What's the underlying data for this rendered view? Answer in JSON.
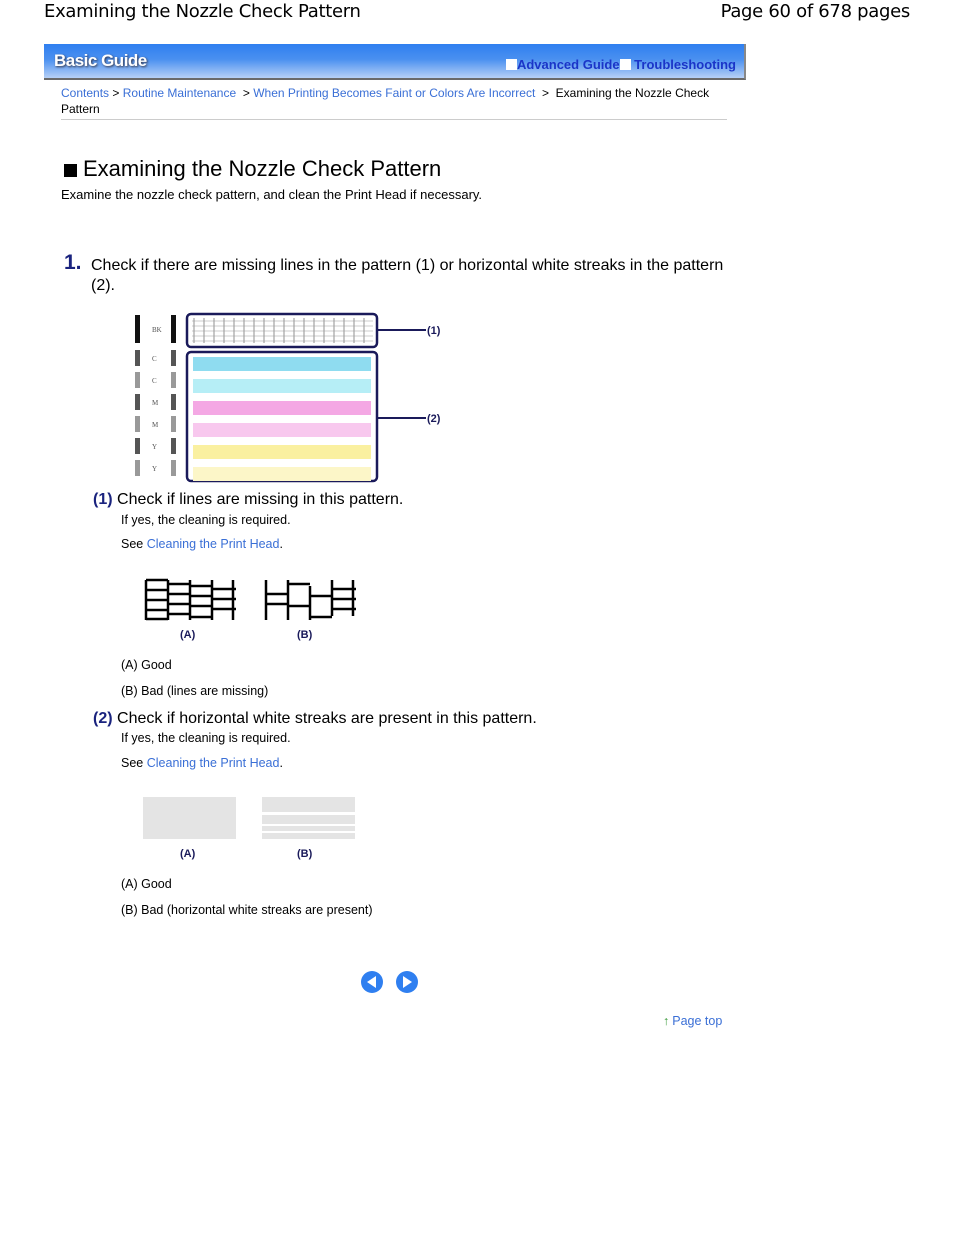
{
  "header": {
    "doc_title": "Examining the Nozzle Check Pattern",
    "page_info": "Page 60 of 678 pages"
  },
  "banner": {
    "logo": "Basic Guide",
    "advanced_guide": "Advanced Guide",
    "troubleshooting": "Troubleshooting"
  },
  "breadcrumb": {
    "items": [
      "Contents",
      "Routine Maintenance",
      "When Printing Becomes Faint or Colors Are Incorrect"
    ],
    "separator": ">",
    "current": "Examining the Nozzle Check Pattern"
  },
  "main": {
    "title": "Examining the Nozzle Check Pattern",
    "intro": "Examine the nozzle check pattern, and clean the Print Head if necessary.",
    "step1": {
      "number": "1.",
      "text": "Check if there are missing lines in the pattern (1) or horizontal white streaks in the pattern (2)."
    },
    "diagram": {
      "callout1": "(1)",
      "callout2": "(2)",
      "row_labels": [
        "BK",
        "C",
        "C",
        "M",
        "M",
        "Y",
        "Y"
      ],
      "band_colors": [
        "#8fdcf0",
        "#b6eef6",
        "#f4a8e4",
        "#f8c8ee",
        "#faf0a0",
        "#fcf6c8"
      ]
    },
    "sub1": {
      "number": "(1)",
      "heading": "Check if lines are missing in this pattern.",
      "note": "If yes, the cleaning is required.",
      "see": "See",
      "link": "Cleaning the Print Head",
      "period": ".",
      "label_a": "(A)",
      "label_b": "(B)",
      "result_a": "(A) Good",
      "result_b": "(B) Bad (lines are missing)"
    },
    "sub2": {
      "number": "(2)",
      "heading": "Check if horizontal white streaks are present in this pattern.",
      "note": "If yes, the cleaning is required.",
      "see": "See",
      "link": "Cleaning the Print Head",
      "period": ".",
      "label_a": "(A)",
      "label_b": "(B)",
      "result_a": "(A) Good",
      "result_b": "(B) Bad (horizontal white streaks are present)"
    }
  },
  "footer": {
    "prev_icon": "previous-page-icon",
    "next_icon": "next-page-icon",
    "page_top": "Page top"
  }
}
